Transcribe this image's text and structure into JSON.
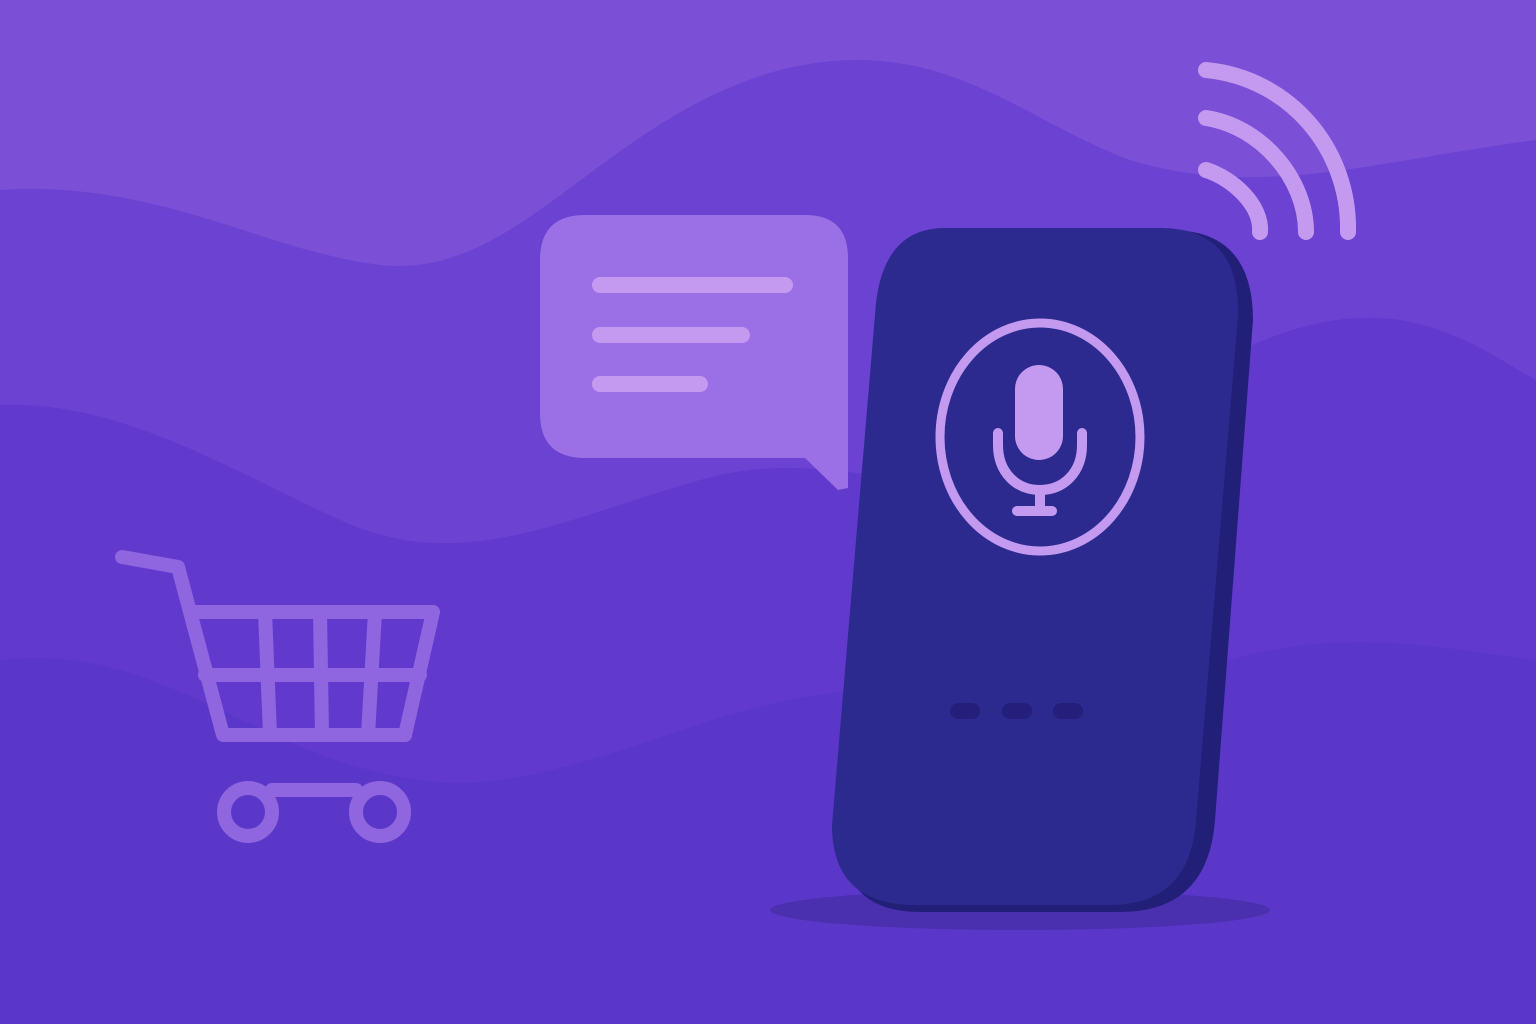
{
  "scene": {
    "description_icons": [
      "shopping-cart-icon",
      "chat-bubble-icon",
      "smart-speaker",
      "microphone-icon",
      "wireless-signal-icon"
    ],
    "colors": {
      "background_top": "#7b4fd6",
      "background_mid": "#6a40d0",
      "background_bottom": "#5a37c8",
      "accent_light": "#c49af0",
      "speaker_body": "#2c2a8f",
      "speaker_side": "#221f78",
      "chat_bubble": "#9b6fe6",
      "cart_stroke": "#8f66e0"
    },
    "speaker": {
      "indicator_dots": 3
    },
    "chat_bubble": {
      "text_lines": 3
    },
    "signal": {
      "arcs": 3
    }
  }
}
